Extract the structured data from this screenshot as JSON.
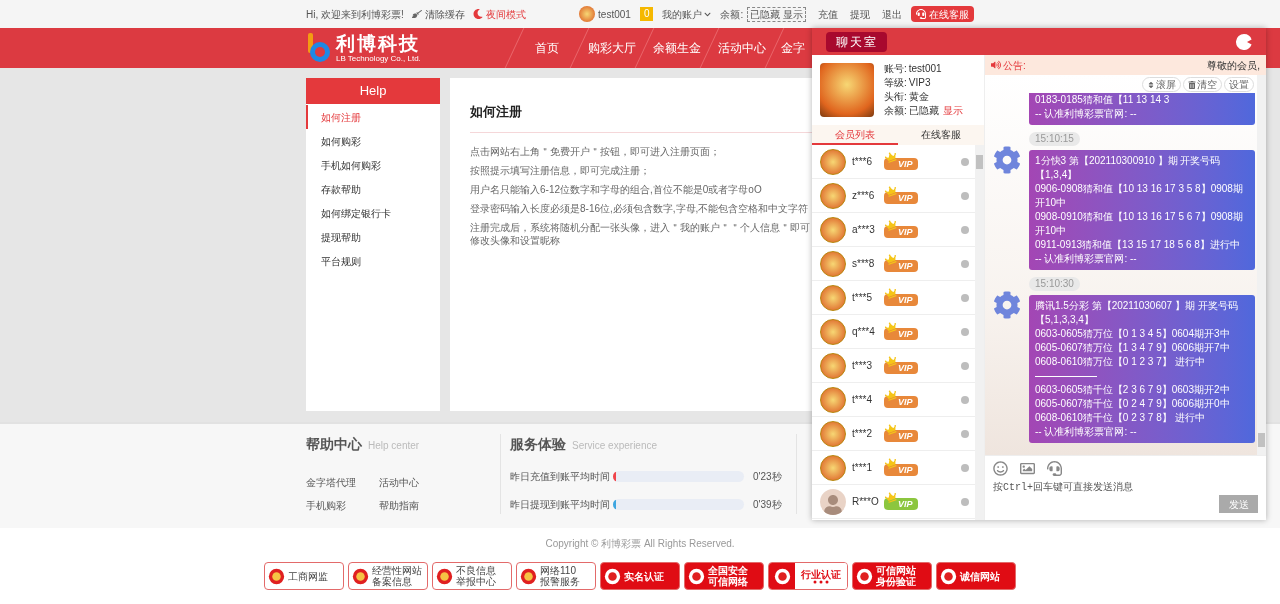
{
  "topbar": {
    "greeting": "Hi, 欢迎来到利博彩票!",
    "clear_cache": "清除缓存",
    "night_mode": "夜间模式",
    "user": "test001",
    "message_count": "0",
    "account_menu": "我的账户",
    "balance_label": "余额:",
    "balance_toggle": "已隐藏 显示",
    "links": [
      "充值",
      "提现",
      "退出"
    ],
    "support_button": "在线客服"
  },
  "header": {
    "logo_title": "利博科技",
    "logo_subtitle": "LB Technology Co., Ltd.",
    "nav": [
      "首页",
      "购彩大厅",
      "余额生金",
      "活动中心",
      "金字"
    ]
  },
  "help_sidebar": {
    "title": "Help",
    "items": [
      {
        "label": "如何注册",
        "selected": true
      },
      {
        "label": "如何购彩",
        "selected": false
      },
      {
        "label": "手机如何购彩",
        "selected": false
      },
      {
        "label": "存款帮助",
        "selected": false
      },
      {
        "label": "如何绑定银行卡",
        "selected": false
      },
      {
        "label": "提现帮助",
        "selected": false
      },
      {
        "label": "平台规则",
        "selected": false
      }
    ]
  },
  "article": {
    "title": "如何注册",
    "paragraphs": [
      "点击网站右上角＂免费开户＂按钮，即可进入注册页面；",
      "按照提示填写注册信息，即可完成注册；",
      "用户名只能输入6-12位数字和字母的组合,首位不能是0或者字母oO",
      "登录密码输入长度必须是8-16位,必须包含数字,字母,不能包含空格和中文字符",
      "注册完成后，系统将随机分配一张头像，进入＂我的账户＂＂个人信息＂即可修改头像和设置昵称"
    ]
  },
  "footer": {
    "help": {
      "title": "帮助中心",
      "subtitle": "Help center",
      "links": [
        "金字塔代理",
        "活动中心",
        "手机购彩",
        "帮助指南"
      ]
    },
    "service": {
      "title": "服务体验",
      "subtitle": "Service experience",
      "meters": [
        {
          "label": "昨日充值到账平均时间",
          "level": 0.02,
          "value": "0'23秒",
          "color": "#f0444a"
        },
        {
          "label": "昨日提现到账平均时间",
          "level": 0.02,
          "value": "0'39秒",
          "color": "#3ea6e0"
        }
      ]
    },
    "copyright": "Copyright © 利博彩票 All Rights Reserved.",
    "badges": [
      {
        "kind": "outline",
        "lines": [
          "工商网监"
        ]
      },
      {
        "kind": "outline",
        "lines": [
          "经营性网站",
          "备案信息"
        ]
      },
      {
        "kind": "outline",
        "lines": [
          "不良信息",
          "举报中心"
        ]
      },
      {
        "kind": "outline",
        "lines": [
          "网络110",
          "报警服务"
        ]
      },
      {
        "kind": "filled",
        "lines": [
          "实名认证"
        ]
      },
      {
        "kind": "filled",
        "lines": [
          "全国安全",
          "可信网络"
        ]
      },
      {
        "kind": "split",
        "lines": [
          "行业认证"
        ]
      },
      {
        "kind": "filled",
        "lines": [
          "可信网站",
          "身份验证"
        ]
      },
      {
        "kind": "filled",
        "lines": [
          "诚信网站"
        ]
      }
    ]
  },
  "chat": {
    "title": "聊天室",
    "profile": {
      "rows": [
        {
          "label": "账号:",
          "value": "test001"
        },
        {
          "label": "等级:",
          "value": "VIP3"
        },
        {
          "label": "头衔:",
          "value": "黄金"
        },
        {
          "label": "余额:",
          "value": "已隐藏",
          "action": "显示"
        }
      ]
    },
    "tabs": [
      {
        "label": "会员列表",
        "selected": true
      },
      {
        "label": "在线客服",
        "selected": false
      }
    ],
    "members": [
      {
        "name": "t***6",
        "kind": "fortune",
        "badge": "VIP",
        "color": "#e8883a",
        "online": false
      },
      {
        "name": "z***6",
        "kind": "fortune",
        "badge": "VIP",
        "color": "#e8883a",
        "online": false
      },
      {
        "name": "a***3",
        "kind": "fortune",
        "badge": "VIP",
        "color": "#e8883a",
        "online": false
      },
      {
        "name": "s***8",
        "kind": "fortune",
        "badge": "VIP",
        "color": "#e8883a",
        "online": false
      },
      {
        "name": "t***5",
        "kind": "fortune",
        "badge": "VIP",
        "color": "#e8883a",
        "online": false
      },
      {
        "name": "q***4",
        "kind": "fortune",
        "badge": "VIP",
        "color": "#e8883a",
        "online": false
      },
      {
        "name": "t***3",
        "kind": "fortune",
        "badge": "VIP",
        "color": "#e8883a",
        "online": false
      },
      {
        "name": "t***4",
        "kind": "fortune",
        "badge": "VIP",
        "color": "#e8883a",
        "online": false
      },
      {
        "name": "t***2",
        "kind": "fortune",
        "badge": "VIP",
        "color": "#e8883a",
        "online": false
      },
      {
        "name": "t***1",
        "kind": "fortune",
        "badge": "VIP",
        "color": "#e8883a",
        "online": false
      },
      {
        "name": "R***O",
        "kind": "photo",
        "badge": "VIP",
        "color": "#8cc63f",
        "online": false
      }
    ],
    "notice_label": "公告:",
    "notice_text": "尊敬的会员,",
    "toolbar": [
      "滚屏",
      "清空",
      "设置"
    ],
    "messages": [
      {
        "lines": [
          {
            "kind": "text",
            "text": "0183-0185猜和值【11 13 14 3"
          },
          {
            "kind": "text",
            "text": "-- 认准利博彩票官网: --"
          }
        ]
      },
      {
        "time": "15:10:15",
        "lines": [
          {
            "kind": "text",
            "text": "1分快3 第【202110300910 】期 开奖号码【1,3,4】"
          },
          {
            "kind": "text",
            "text": "0906-0908猜和值【10 13 16 17 3 5 8】0908期开10中"
          },
          {
            "kind": "text",
            "text": "0908-0910猜和值【10 13 16 17 5 6 7】0908期开10中"
          },
          {
            "kind": "text",
            "text": "0911-0913猜和值【13 15 17 18 5 6 8】进行中"
          },
          {
            "kind": "text",
            "text": "-- 认准利博彩票官网: --"
          }
        ]
      },
      {
        "time": "15:10:30",
        "lines": [
          {
            "kind": "text",
            "text": "腾讯1.5分彩 第【20211030607 】期 开奖号码【5,1,3,3,4】"
          },
          {
            "kind": "text",
            "text": "0603-0605猜万位【0 1 3 4 5】0604期开3中"
          },
          {
            "kind": "text",
            "text": "0605-0607猜万位【1 3 4 7 9】0606期开7中"
          },
          {
            "kind": "text",
            "text": "0608-0610猜万位【0 1 2 3 7】 进行中"
          },
          {
            "kind": "rule"
          },
          {
            "kind": "text",
            "text": "0603-0605猜千位【2 3 6 7 9】0603期开2中"
          },
          {
            "kind": "text",
            "text": "0605-0607猜千位【0 2 4 7 9】0606期开0中"
          },
          {
            "kind": "text",
            "text": "0608-0610猜千位【0 2 3 7 8】 进行中"
          },
          {
            "kind": "text",
            "text": "-- 认准利博彩票官网: --"
          }
        ]
      }
    ],
    "input_placeholder": "按Ctrl+回车键可直接发送消息",
    "send_button": "发送"
  }
}
